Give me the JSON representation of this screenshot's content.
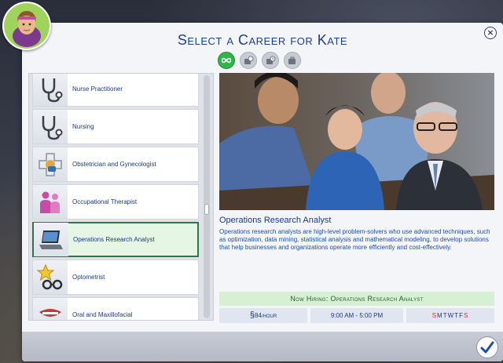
{
  "dialog": {
    "title": "Select a Career for Kate",
    "close_label": "×"
  },
  "mode_icons": [
    {
      "name": "infinite-career-icon",
      "state": "active"
    },
    {
      "name": "part-time-icon",
      "state": "inactive"
    },
    {
      "name": "scheduled-icon",
      "state": "inactive"
    },
    {
      "name": "freelance-icon",
      "state": "inactive"
    }
  ],
  "careers": [
    {
      "label": "Nurse Practitioner",
      "icon": "stethoscope-icon"
    },
    {
      "label": "Nursing",
      "icon": "stethoscope-icon"
    },
    {
      "label": "Obstetrician and Gynecologist",
      "icon": "medical-cross-icon"
    },
    {
      "label": "Occupational Therapist",
      "icon": "people-icon"
    },
    {
      "label": "Operations Research Analyst",
      "icon": "laptop-icon",
      "selected": true
    },
    {
      "label": "Optometrist",
      "icon": "glasses-star-icon"
    },
    {
      "label": "Oral and Maxillofacial",
      "icon": "mouth-icon"
    }
  ],
  "detail": {
    "title": "Operations Research Analyst",
    "description": "Operations research analysts are high-level problem-solvers who use advanced techniques, such as optimization, data mining, statistical analysis and mathematical modeling, to develop solutions that help businesses and organizations operate more efficiently and cost-effectively.",
    "hiring": "Now Hiring: Operations Research Analyst",
    "pay_symbol": "§",
    "pay_amount": "84",
    "pay_unit": "/HOUR",
    "hours": "9:00 AM - 5:00 PM",
    "days": [
      "S",
      "M",
      "T",
      "W",
      "T",
      "F",
      "S"
    ],
    "days_off": [
      0,
      6
    ]
  },
  "colors": {
    "accent": "#1a3a86",
    "selected_border": "#2b7a3d",
    "hiring_bg": "#d7efd2",
    "active_mode": "#2fb54a"
  }
}
